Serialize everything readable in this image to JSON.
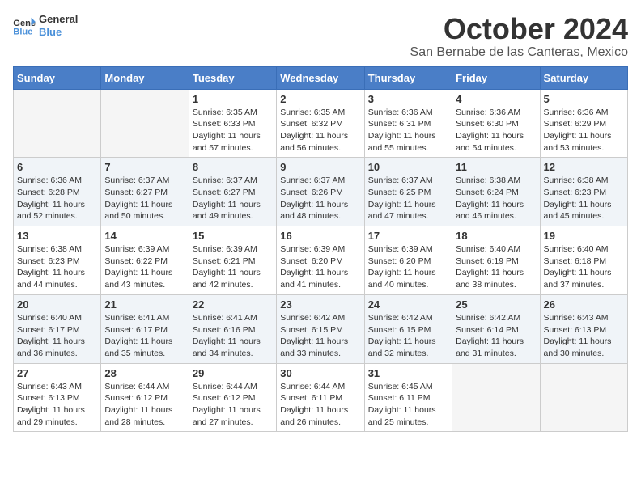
{
  "logo": {
    "line1": "General",
    "line2": "Blue"
  },
  "title": "October 2024",
  "location": "San Bernabe de las Canteras, Mexico",
  "weekdays": [
    "Sunday",
    "Monday",
    "Tuesday",
    "Wednesday",
    "Thursday",
    "Friday",
    "Saturday"
  ],
  "weeks": [
    [
      {
        "day": "",
        "empty": true
      },
      {
        "day": "",
        "empty": true
      },
      {
        "day": "1",
        "sunrise": "6:35 AM",
        "sunset": "6:33 PM",
        "daylight": "11 hours and 57 minutes."
      },
      {
        "day": "2",
        "sunrise": "6:35 AM",
        "sunset": "6:32 PM",
        "daylight": "11 hours and 56 minutes."
      },
      {
        "day": "3",
        "sunrise": "6:36 AM",
        "sunset": "6:31 PM",
        "daylight": "11 hours and 55 minutes."
      },
      {
        "day": "4",
        "sunrise": "6:36 AM",
        "sunset": "6:30 PM",
        "daylight": "11 hours and 54 minutes."
      },
      {
        "day": "5",
        "sunrise": "6:36 AM",
        "sunset": "6:29 PM",
        "daylight": "11 hours and 53 minutes."
      }
    ],
    [
      {
        "day": "6",
        "sunrise": "6:36 AM",
        "sunset": "6:28 PM",
        "daylight": "11 hours and 52 minutes."
      },
      {
        "day": "7",
        "sunrise": "6:37 AM",
        "sunset": "6:27 PM",
        "daylight": "11 hours and 50 minutes."
      },
      {
        "day": "8",
        "sunrise": "6:37 AM",
        "sunset": "6:27 PM",
        "daylight": "11 hours and 49 minutes."
      },
      {
        "day": "9",
        "sunrise": "6:37 AM",
        "sunset": "6:26 PM",
        "daylight": "11 hours and 48 minutes."
      },
      {
        "day": "10",
        "sunrise": "6:37 AM",
        "sunset": "6:25 PM",
        "daylight": "11 hours and 47 minutes."
      },
      {
        "day": "11",
        "sunrise": "6:38 AM",
        "sunset": "6:24 PM",
        "daylight": "11 hours and 46 minutes."
      },
      {
        "day": "12",
        "sunrise": "6:38 AM",
        "sunset": "6:23 PM",
        "daylight": "11 hours and 45 minutes."
      }
    ],
    [
      {
        "day": "13",
        "sunrise": "6:38 AM",
        "sunset": "6:23 PM",
        "daylight": "11 hours and 44 minutes."
      },
      {
        "day": "14",
        "sunrise": "6:39 AM",
        "sunset": "6:22 PM",
        "daylight": "11 hours and 43 minutes."
      },
      {
        "day": "15",
        "sunrise": "6:39 AM",
        "sunset": "6:21 PM",
        "daylight": "11 hours and 42 minutes."
      },
      {
        "day": "16",
        "sunrise": "6:39 AM",
        "sunset": "6:20 PM",
        "daylight": "11 hours and 41 minutes."
      },
      {
        "day": "17",
        "sunrise": "6:39 AM",
        "sunset": "6:20 PM",
        "daylight": "11 hours and 40 minutes."
      },
      {
        "day": "18",
        "sunrise": "6:40 AM",
        "sunset": "6:19 PM",
        "daylight": "11 hours and 38 minutes."
      },
      {
        "day": "19",
        "sunrise": "6:40 AM",
        "sunset": "6:18 PM",
        "daylight": "11 hours and 37 minutes."
      }
    ],
    [
      {
        "day": "20",
        "sunrise": "6:40 AM",
        "sunset": "6:17 PM",
        "daylight": "11 hours and 36 minutes."
      },
      {
        "day": "21",
        "sunrise": "6:41 AM",
        "sunset": "6:17 PM",
        "daylight": "11 hours and 35 minutes."
      },
      {
        "day": "22",
        "sunrise": "6:41 AM",
        "sunset": "6:16 PM",
        "daylight": "11 hours and 34 minutes."
      },
      {
        "day": "23",
        "sunrise": "6:42 AM",
        "sunset": "6:15 PM",
        "daylight": "11 hours and 33 minutes."
      },
      {
        "day": "24",
        "sunrise": "6:42 AM",
        "sunset": "6:15 PM",
        "daylight": "11 hours and 32 minutes."
      },
      {
        "day": "25",
        "sunrise": "6:42 AM",
        "sunset": "6:14 PM",
        "daylight": "11 hours and 31 minutes."
      },
      {
        "day": "26",
        "sunrise": "6:43 AM",
        "sunset": "6:13 PM",
        "daylight": "11 hours and 30 minutes."
      }
    ],
    [
      {
        "day": "27",
        "sunrise": "6:43 AM",
        "sunset": "6:13 PM",
        "daylight": "11 hours and 29 minutes."
      },
      {
        "day": "28",
        "sunrise": "6:44 AM",
        "sunset": "6:12 PM",
        "daylight": "11 hours and 28 minutes."
      },
      {
        "day": "29",
        "sunrise": "6:44 AM",
        "sunset": "6:12 PM",
        "daylight": "11 hours and 27 minutes."
      },
      {
        "day": "30",
        "sunrise": "6:44 AM",
        "sunset": "6:11 PM",
        "daylight": "11 hours and 26 minutes."
      },
      {
        "day": "31",
        "sunrise": "6:45 AM",
        "sunset": "6:11 PM",
        "daylight": "11 hours and 25 minutes."
      },
      {
        "day": "",
        "empty": true
      },
      {
        "day": "",
        "empty": true
      }
    ]
  ]
}
